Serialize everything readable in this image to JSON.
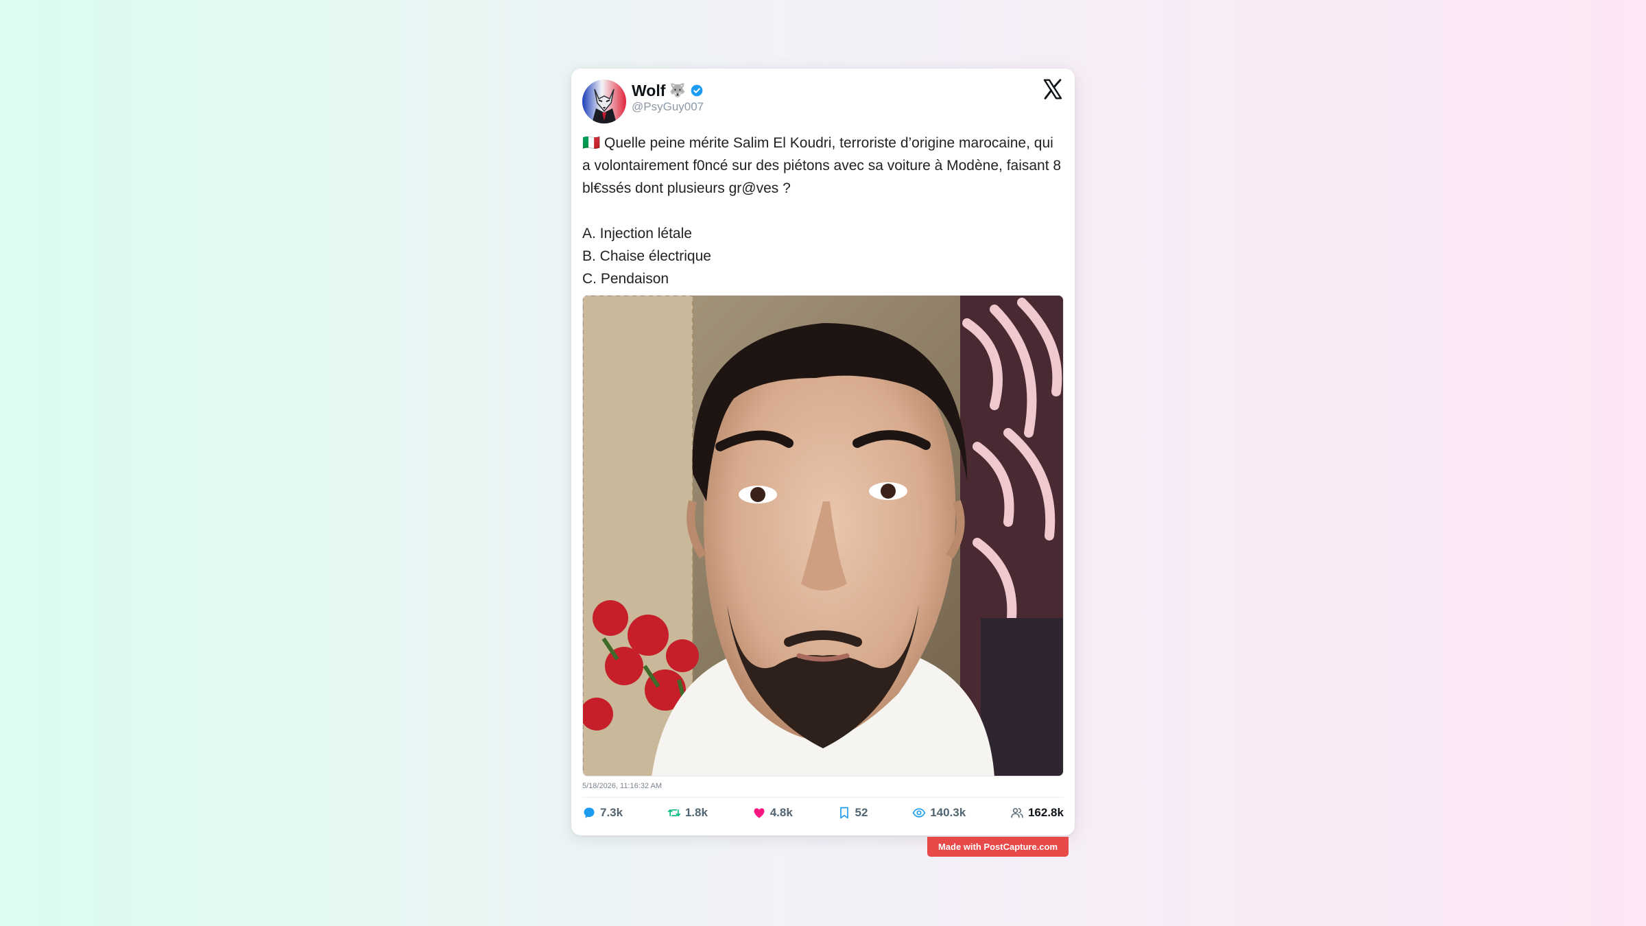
{
  "post": {
    "author_name": "Wolf",
    "author_emoji": "🐺",
    "handle": "@PsyGuy007",
    "text_line1": "🇮🇹 Quelle peine mérite Salim El Koudri, terroriste d’origine marocaine, qui a volontairement f0ncé sur des piétons avec sa voiture à Modène, faisant 8 bl€ssés dont plusieurs gr@ves ?",
    "option_a": "A. Injection létale",
    "option_b": "B. Chaise électrique",
    "option_c": "C. Pendaison",
    "timestamp": "5/18/2026, 11:16:32 AM"
  },
  "stats": {
    "replies": "7.3k",
    "reposts": "1.8k",
    "likes": "4.8k",
    "bookmarks": "52",
    "views": "140.3k",
    "followers": "162.8k"
  },
  "colors": {
    "reply_icon": "#1d9bf0",
    "repost_icon": "#00ba7c",
    "like_icon": "#f91880",
    "bookmark_icon": "#1d9bf0",
    "views_icon": "#1d9bf0",
    "verified": "#1d9bf0",
    "badge_bg": "#e74848"
  },
  "watermark": "Made with PostCapture.com"
}
